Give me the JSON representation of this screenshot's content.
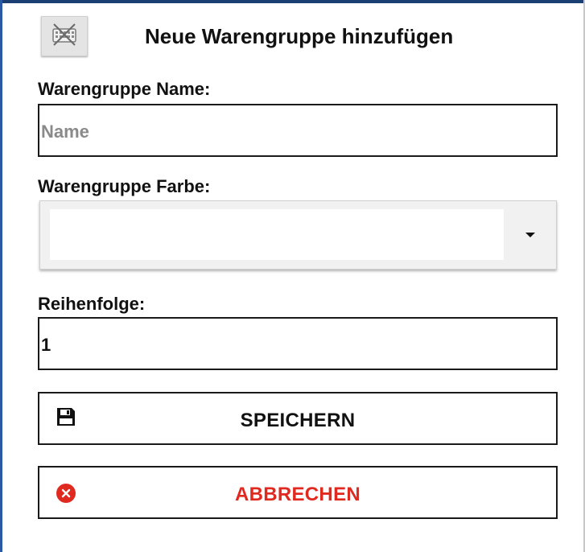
{
  "dialog": {
    "title": "Neue Warengruppe hinzufügen"
  },
  "icons": {
    "keyboard_toggle": "keyboard-off-icon",
    "save": "floppy-disk-icon",
    "cancel": "close-circle-icon",
    "dropdown": "caret-down-icon"
  },
  "form": {
    "name_label": "Warengruppe Name:",
    "name_value": "",
    "name_placeholder": "Name",
    "color_label": "Warengruppe Farbe:",
    "color_value": "",
    "order_label": "Reihenfolge:",
    "order_value": "1"
  },
  "actions": {
    "save_label": "SPEICHERN",
    "cancel_label": "ABBRECHEN"
  },
  "colors": {
    "cancel_accent": "#e0291f",
    "frame_edge": "#1b3f73"
  }
}
